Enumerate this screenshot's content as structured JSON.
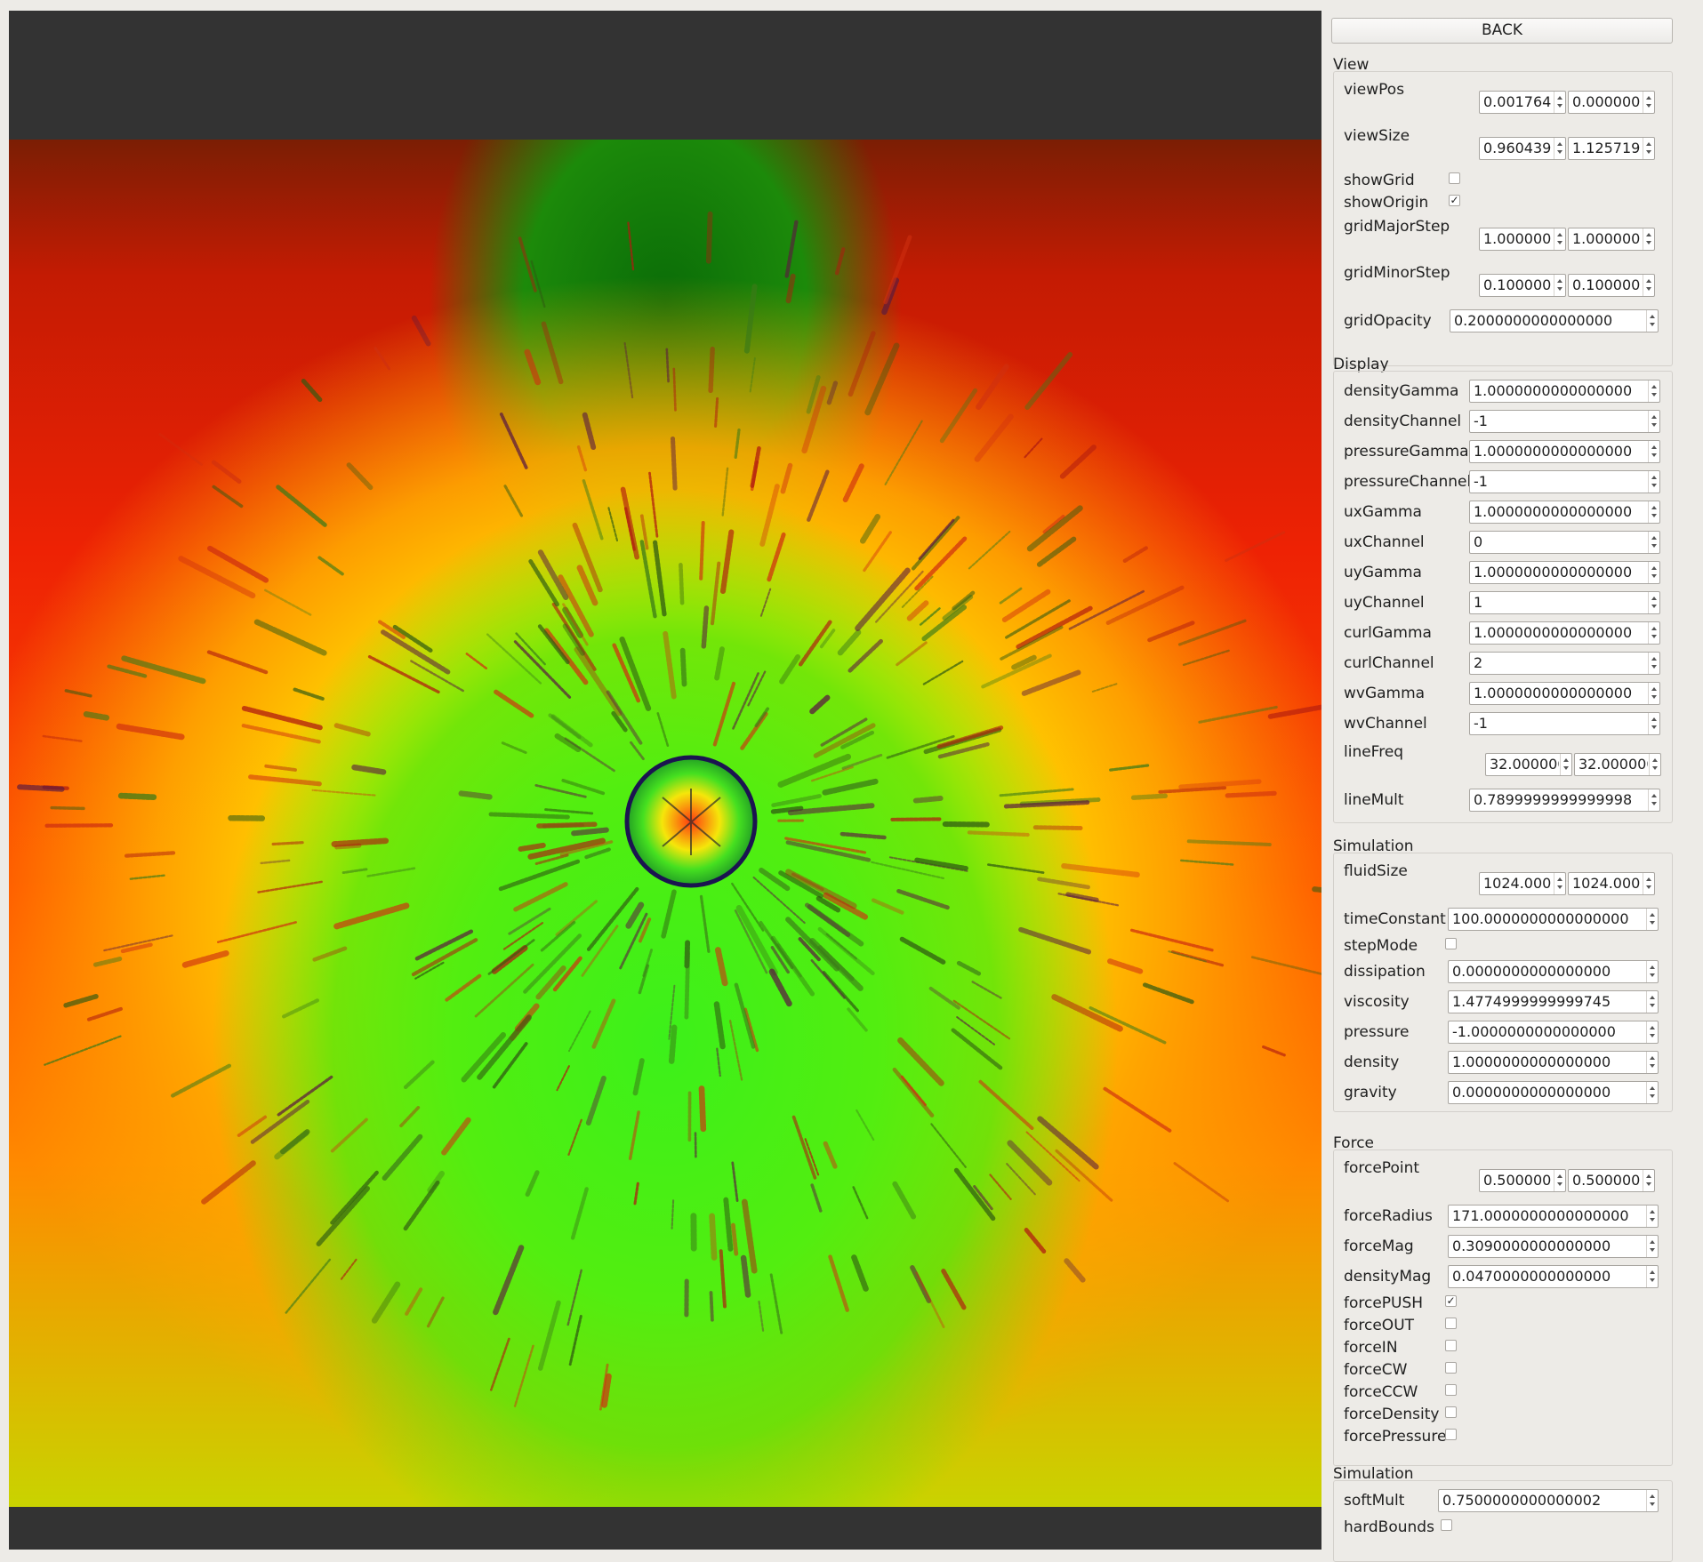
{
  "panel": {
    "back_label": "BACK",
    "groups": [
      {
        "title": "View",
        "rows": [
          {
            "label": "viewPos",
            "type": "vec2",
            "values": [
              "0.001764",
              "0.000000"
            ]
          },
          {
            "label": "viewSize",
            "type": "vec2",
            "values": [
              "0.960439",
              "1.125719"
            ]
          },
          {
            "label": "showGrid",
            "type": "check",
            "checked": false
          },
          {
            "label": "showOrigin",
            "type": "check",
            "checked": true
          },
          {
            "label": "gridMajorStep",
            "type": "vec2",
            "values": [
              "1.000000",
              "1.000000"
            ]
          },
          {
            "label": "gridMinorStep",
            "type": "vec2",
            "values": [
              "0.100000",
              "0.100000"
            ]
          },
          {
            "label": "gridOpacity",
            "type": "num",
            "value": "0.2000000000000000"
          }
        ]
      },
      {
        "title": "Display",
        "rows": [
          {
            "label": "densityGamma",
            "type": "num",
            "value": "1.0000000000000000"
          },
          {
            "label": "densityChannel",
            "type": "num",
            "value": "-1"
          },
          {
            "label": "pressureGamma",
            "type": "num",
            "value": "1.0000000000000000"
          },
          {
            "label": "pressureChannel",
            "type": "num",
            "value": "-1"
          },
          {
            "label": "uxGamma",
            "type": "num",
            "value": "1.0000000000000000"
          },
          {
            "label": "uxChannel",
            "type": "num",
            "value": "0"
          },
          {
            "label": "uyGamma",
            "type": "num",
            "value": "1.0000000000000000"
          },
          {
            "label": "uyChannel",
            "type": "num",
            "value": "1"
          },
          {
            "label": "curlGamma",
            "type": "num",
            "value": "1.0000000000000000"
          },
          {
            "label": "curlChannel",
            "type": "num",
            "value": "2"
          },
          {
            "label": "wvGamma",
            "type": "num",
            "value": "1.0000000000000000"
          },
          {
            "label": "wvChannel",
            "type": "num",
            "value": "-1"
          },
          {
            "label": "lineFreq",
            "type": "vec2",
            "values": [
              "32.000000",
              "32.000000"
            ]
          },
          {
            "label": "lineMult",
            "type": "num",
            "value": "0.7899999999999998"
          }
        ]
      },
      {
        "title": "Simulation",
        "rows": [
          {
            "label": "fluidSize",
            "type": "vec2",
            "values": [
              "1024.000",
              "1024.000"
            ]
          },
          {
            "label": "timeConstant",
            "type": "num",
            "value": "100.0000000000000000"
          },
          {
            "label": "stepMode",
            "type": "check",
            "checked": false
          },
          {
            "label": "dissipation",
            "type": "num",
            "value": "0.0000000000000000"
          },
          {
            "label": "viscosity",
            "type": "num",
            "value": "1.4774999999999745"
          },
          {
            "label": "pressure",
            "type": "num",
            "value": "-1.0000000000000000"
          },
          {
            "label": "density",
            "type": "num",
            "value": "1.0000000000000000"
          },
          {
            "label": "gravity",
            "type": "num",
            "value": "0.0000000000000000"
          }
        ]
      },
      {
        "title": "Force",
        "rows": [
          {
            "label": "forcePoint",
            "type": "vec2",
            "values": [
              "0.500000",
              "0.500000"
            ]
          },
          {
            "label": "forceRadius",
            "type": "num",
            "value": "171.0000000000000000"
          },
          {
            "label": "forceMag",
            "type": "num",
            "value": "0.3090000000000000"
          },
          {
            "label": "densityMag",
            "type": "num",
            "value": "0.0470000000000000"
          },
          {
            "label": "forcePUSH",
            "type": "check",
            "checked": true
          },
          {
            "label": "forceOUT",
            "type": "check",
            "checked": false
          },
          {
            "label": "forceIN",
            "type": "check",
            "checked": false
          },
          {
            "label": "forceCW",
            "type": "check",
            "checked": false
          },
          {
            "label": "forceCCW",
            "type": "check",
            "checked": false
          },
          {
            "label": "forceDensity",
            "type": "check",
            "checked": false
          },
          {
            "label": "forcePressure",
            "type": "check",
            "checked": false
          }
        ]
      },
      {
        "title": "Simulation",
        "rows": [
          {
            "label": "softMult",
            "type": "num",
            "value": "0.7500000000000002"
          },
          {
            "label": "hardBounds",
            "type": "check",
            "checked": false
          }
        ]
      }
    ]
  }
}
